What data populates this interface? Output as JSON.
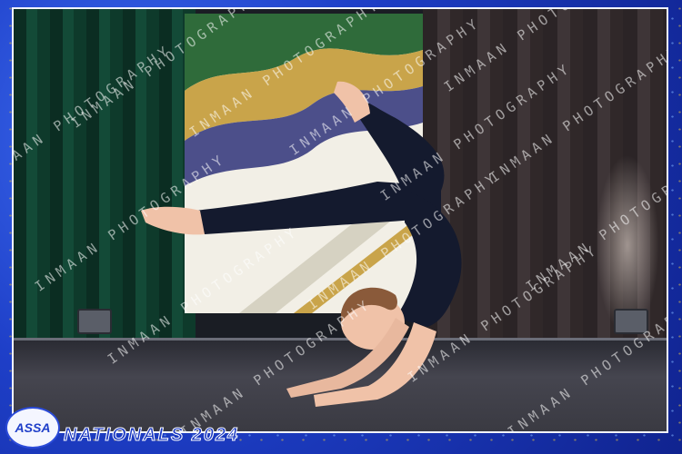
{
  "event": {
    "logo_text": "ASSA",
    "title": "NATIONALS 2024"
  },
  "watermark": {
    "text": "INMAAN PHOTOGRAPHY"
  },
  "colors": {
    "frame_blue": "#1e3fc8",
    "frame_gold": "#d9b84a",
    "leotard": "#141a2e"
  }
}
